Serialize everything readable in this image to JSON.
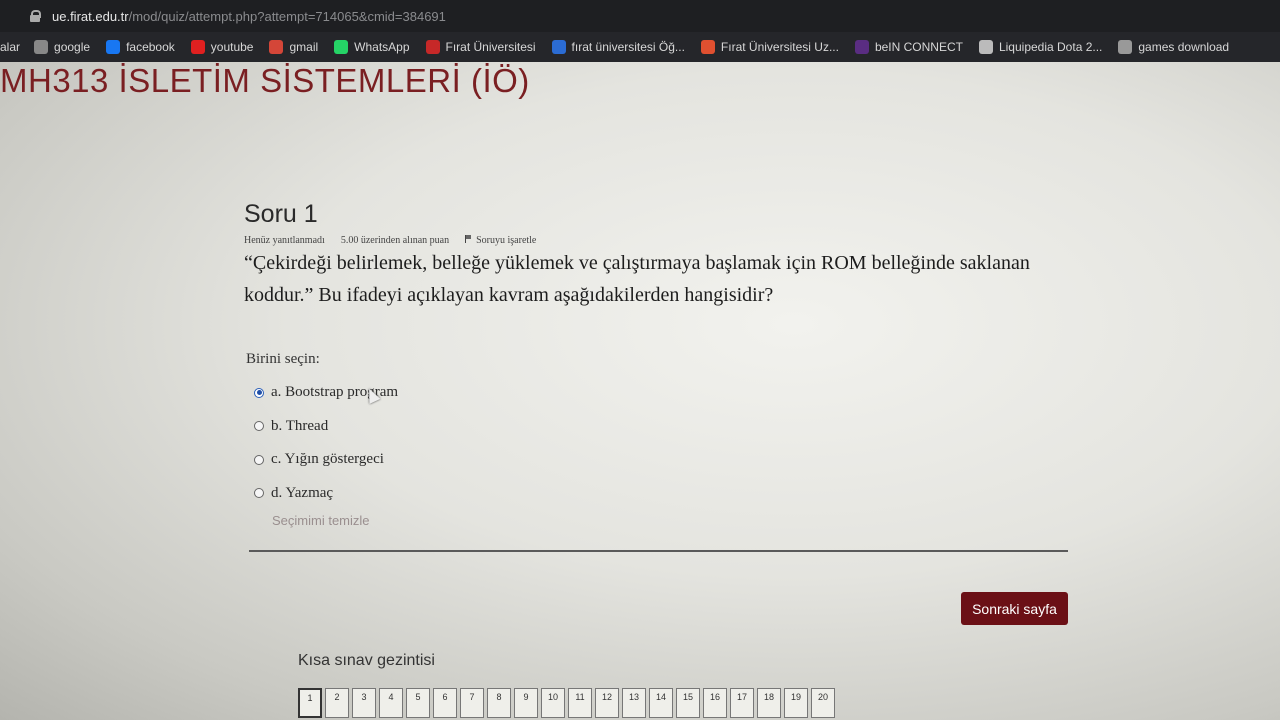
{
  "browser": {
    "url_host": "ue.firat.edu.tr",
    "url_path": "/mod/quiz/attempt.php?attempt=714065&cmid=384691",
    "bookmarks_prefix": "alar",
    "bookmarks": [
      {
        "label": "google",
        "icon": "google-icon",
        "color": "#888888"
      },
      {
        "label": "facebook",
        "icon": "facebook-icon",
        "color": "#1877f2"
      },
      {
        "label": "youtube",
        "icon": "youtube-icon",
        "color": "#e02020"
      },
      {
        "label": "gmail",
        "icon": "gmail-icon",
        "color": "#d44638"
      },
      {
        "label": "WhatsApp",
        "icon": "whatsapp-icon",
        "color": "#25d366"
      },
      {
        "label": "Fırat Üniversitesi",
        "icon": "firat-icon",
        "color": "#c62828"
      },
      {
        "label": "fırat üniversitesi Öğ...",
        "icon": "globe-icon",
        "color": "#2b6cd4"
      },
      {
        "label": "Fırat Üniversitesi Uz...",
        "icon": "circle-logo-icon",
        "color": "#e05030"
      },
      {
        "label": "beIN CONNECT",
        "icon": "bein-icon",
        "color": "#5a2d82"
      },
      {
        "label": "Liquipedia Dota 2...",
        "icon": "star-icon",
        "color": "#bbbbbb"
      },
      {
        "label": "games download",
        "icon": "wordpress-icon",
        "color": "#999999"
      }
    ]
  },
  "course": {
    "title": "MH313 İSLETİM SİSTEMLERİ (İÖ)"
  },
  "question": {
    "title": "Soru 1",
    "status": "Henüz yanıtlanmadı",
    "points": "5.00 üzerinden alınan puan",
    "flag_label": "Soruyu işaretle",
    "text": "“Çekirdeği belirlemek, belleğe yüklemek ve çalıştırmaya başlamak için ROM belleğinde saklanan koddur.” Bu ifadeyi açıklayan kavram aşağıdakilerden hangisidir?",
    "prompt": "Birini seçin:",
    "answers": [
      {
        "label": "a. Bootstrap program",
        "selected": true
      },
      {
        "label": "b. Thread",
        "selected": false
      },
      {
        "label": "c. Yığın göstergeci",
        "selected": false
      },
      {
        "label": "d. Yazmaç",
        "selected": false
      }
    ],
    "clear_label": "Seçimimi temizle"
  },
  "next_button": "Sonraki sayfa",
  "quiz_nav": {
    "title": "Kısa sınav gezintisi",
    "items": [
      "1",
      "2",
      "3",
      "4",
      "5",
      "6",
      "7",
      "8",
      "9",
      "10",
      "11",
      "12",
      "13",
      "14",
      "15",
      "16",
      "17",
      "18",
      "19",
      "20"
    ],
    "current": "1"
  },
  "colors": {
    "accent": "#6b1016",
    "title": "#7a1f22",
    "selected_radio": "#1f4fa8"
  }
}
